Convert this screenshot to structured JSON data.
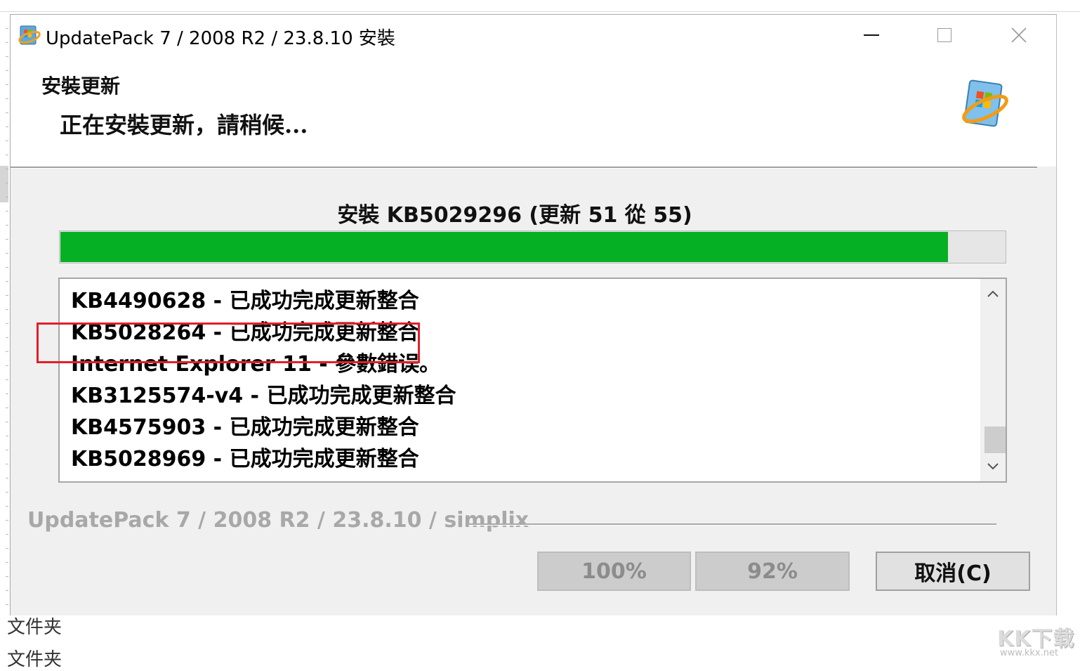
{
  "window": {
    "title": "UpdatePack 7 / 2008 R2 / 23.8.10 安裝",
    "controls": [
      "minimize-icon",
      "maximize-icon",
      "close-icon"
    ]
  },
  "header": {
    "title": "安裝更新",
    "subtitle": "正在安裝更新，請稍候...",
    "logo_icon": "windows-update-icon"
  },
  "progress": {
    "status": "安裝 KB5029296 (更新 51 從 55)",
    "fraction": 0.94,
    "fill_color": "#06b025"
  },
  "log": {
    "lines": [
      "KB4490628 - 已成功完成更新整合",
      "KB5028264 - 已成功完成更新整合",
      "Internet Explorer 11 - 參數錯误。",
      "KB3125574-v4 - 已成功完成更新整合",
      "KB4575903 - 已成功完成更新整合",
      "KB5028969 - 已成功完成更新整合"
    ],
    "highlight_color": "#e0202a"
  },
  "footer": {
    "brand": "UpdatePack 7 / 2008 R2 / 23.8.10 / simplix",
    "buttons": {
      "progress_total": "100%",
      "progress_current": "92%",
      "cancel": "取消(C)"
    }
  },
  "background": {
    "folder_labels": [
      "文件夹",
      "文件夹"
    ]
  },
  "watermark": {
    "logo": "KK下载",
    "url": "www.kkx.net"
  }
}
